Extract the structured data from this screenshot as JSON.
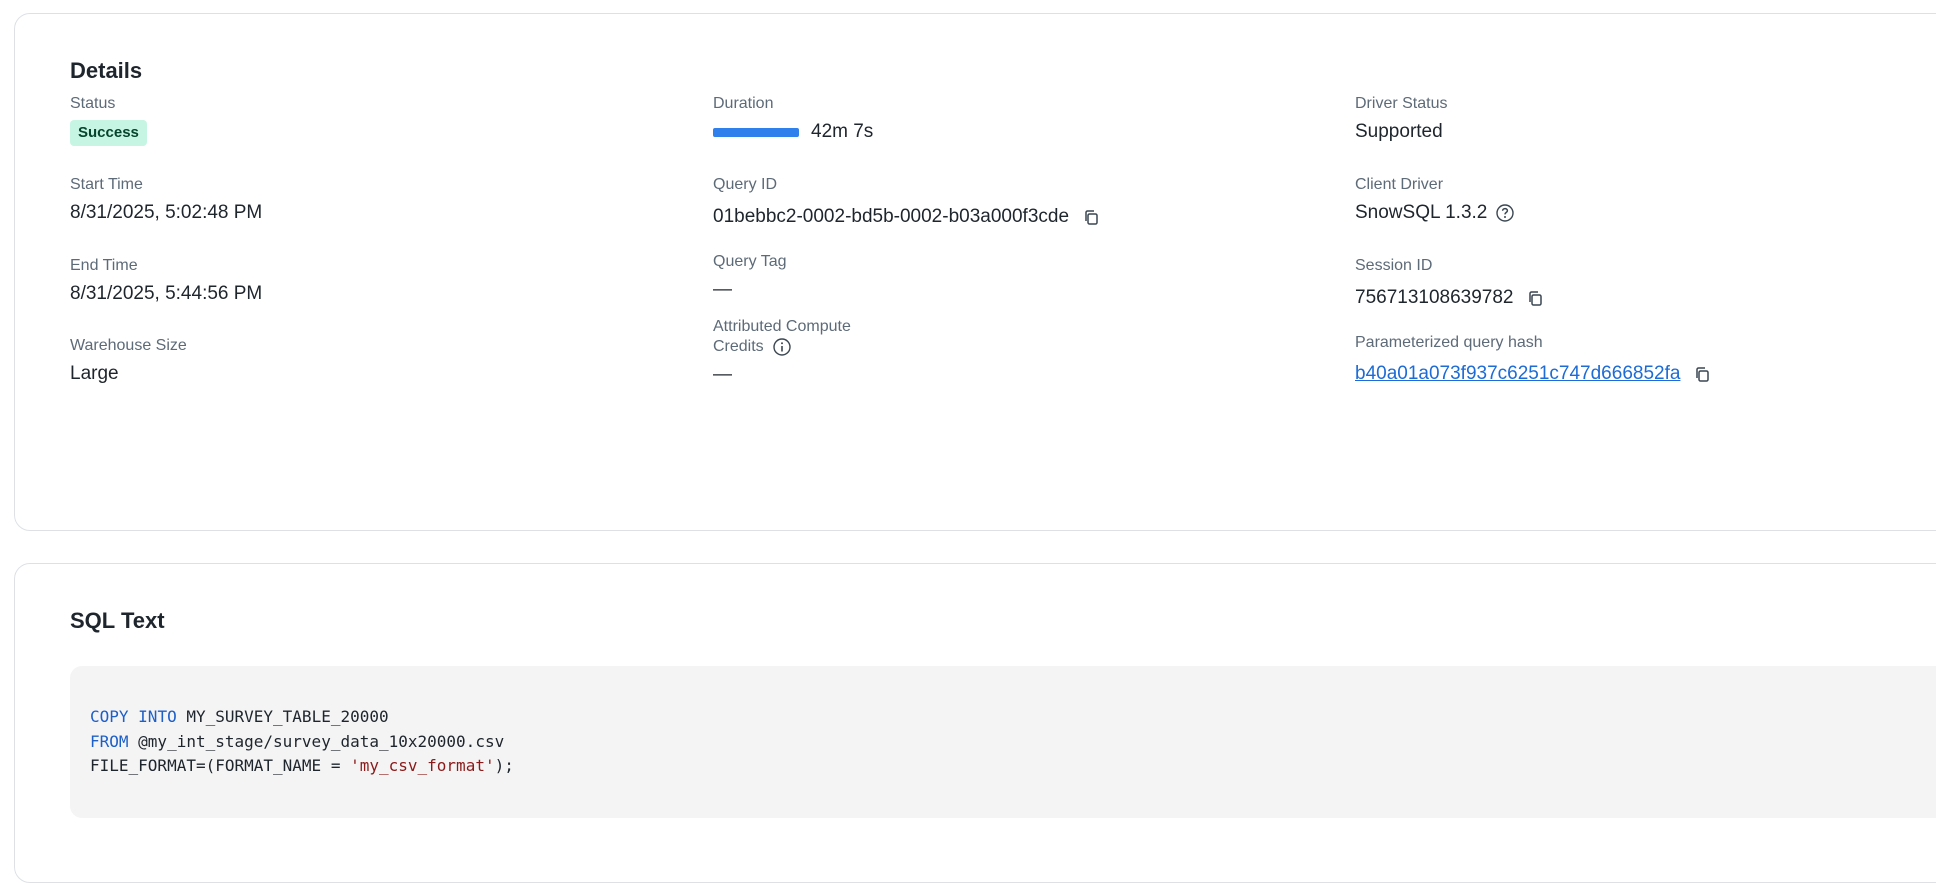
{
  "details": {
    "title": "Details",
    "status": {
      "label": "Status",
      "value": "Success"
    },
    "duration": {
      "label": "Duration",
      "value": "42m 7s"
    },
    "driver_status": {
      "label": "Driver Status",
      "value": "Supported"
    },
    "start_time": {
      "label": "Start Time",
      "value": "8/31/2025, 5:02:48 PM"
    },
    "query_id": {
      "label": "Query ID",
      "value": "01bebbc2-0002-bd5b-0002-b03a000f3cde"
    },
    "client_driver": {
      "label": "Client Driver",
      "value": "SnowSQL 1.3.2"
    },
    "end_time": {
      "label": "End Time",
      "value": "8/31/2025, 5:44:56 PM"
    },
    "query_tag": {
      "label": "Query Tag",
      "value": "—"
    },
    "session_id": {
      "label": "Session ID",
      "value": "756713108639782"
    },
    "warehouse_size": {
      "label": "Warehouse Size",
      "value": "Large"
    },
    "attributed_credits": {
      "label_line1": "Attributed Compute",
      "label_line2": "Credits",
      "value": "—"
    },
    "param_hash": {
      "label": "Parameterized query hash",
      "value": "b40a01a073f937c6251c747d666852fa"
    }
  },
  "sql": {
    "title": "SQL Text",
    "line1": {
      "kw1": "COPY",
      "kw2": "INTO",
      "rest": " MY_SURVEY_TABLE_20000"
    },
    "line2": {
      "kw": "FROM",
      "rest": " @my_int_stage/survey_data_10x20000.csv"
    },
    "line3": {
      "pre": "FILE_FORMAT=(FORMAT_NAME = ",
      "str": "'my_csv_format'",
      "post": ");"
    }
  },
  "icons": [
    "copy-icon",
    "help-circle-icon",
    "info-icon"
  ]
}
